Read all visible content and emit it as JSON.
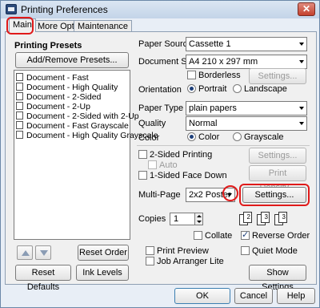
{
  "window": {
    "title": "Printing Preferences",
    "close_glyph": "✕"
  },
  "tabs": [
    {
      "label": "Main",
      "active": true
    },
    {
      "label": "More Options",
      "active": false
    },
    {
      "label": "Maintenance",
      "active": false
    }
  ],
  "presets": {
    "heading": "Printing Presets",
    "add_remove_label": "Add/Remove Presets...",
    "items": [
      "Document - Fast",
      "Document - High Quality",
      "Document - 2-Sided",
      "Document - 2-Up",
      "Document - 2-Sided with 2-Up",
      "Document - Fast Grayscale",
      "Document - High Quality Grayscale"
    ],
    "reset_order_label": "Reset Order"
  },
  "paper": {
    "source_label": "Paper Source",
    "source_value": "Cassette 1",
    "size_label": "Document Size",
    "size_value": "A4 210 x 297 mm",
    "borderless_label": "Borderless",
    "settings_label": "Settings...",
    "orientation_label": "Orientation",
    "portrait_label": "Portrait",
    "landscape_label": "Landscape",
    "type_label": "Paper Type",
    "type_value": "plain papers",
    "quality_label": "Quality",
    "quality_value": "Normal",
    "color_label": "Color",
    "color_option": "Color",
    "grayscale_option": "Grayscale"
  },
  "duplex": {
    "two_sided_label": "2-Sided Printing",
    "settings_label": "Settings...",
    "auto_label": "Auto",
    "print_density_label": "Print Density...",
    "one_sided_face_down_label": "1-Sided Face Down"
  },
  "multipage": {
    "label": "Multi-Page",
    "value": "2x2 Poster",
    "settings_label": "Settings..."
  },
  "copies": {
    "label": "Copies",
    "value": "1",
    "collate_label": "Collate",
    "reverse_order_label": "Reverse Order"
  },
  "options": {
    "print_preview_label": "Print Preview",
    "job_arranger_label": "Job Arranger Lite",
    "quiet_mode_label": "Quiet Mode"
  },
  "footer": {
    "reset_defaults_label": "Reset Defaults",
    "ink_levels_label": "Ink Levels",
    "show_settings_label": "Show Settings"
  },
  "dialog": {
    "ok_label": "OK",
    "cancel_label": "Cancel",
    "help_label": "Help"
  },
  "colors": {
    "highlight": "#e01a1a",
    "checkbox_mark": "#1d3f7a"
  }
}
